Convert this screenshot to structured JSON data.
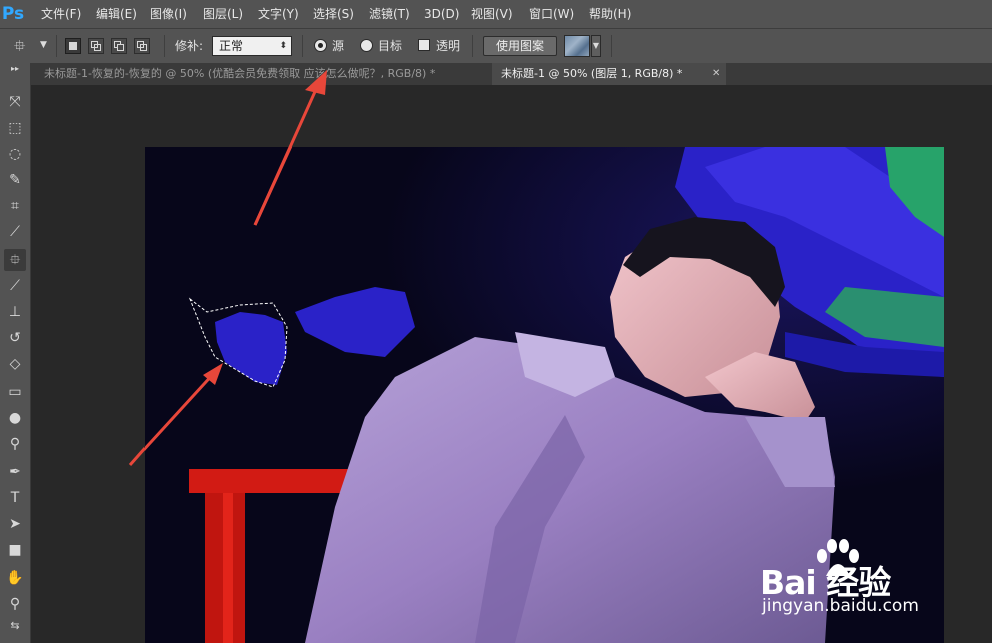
{
  "app": {
    "logo": "Ps"
  },
  "menu": [
    "文件(F)",
    "编辑(E)",
    "图像(I)",
    "图层(L)",
    "文字(Y)",
    "选择(S)",
    "滤镜(T)",
    "3D(D)",
    "视图(V)",
    "窗口(W)",
    "帮助(H)"
  ],
  "options": {
    "patch_label": "修补:",
    "patch_mode": "正常",
    "source_label": "源",
    "target_label": "目标",
    "transparent_label": "透明",
    "use_pattern_label": "使用图案"
  },
  "tabs": [
    {
      "title": "未标题-1-恢复的-恢复的 @ 50% (优酷会员免费领取 应该怎么做呢？, RGB/8) *",
      "active": false
    },
    {
      "title": "未标题-1 @ 50% (图层 1, RGB/8) *",
      "active": true
    }
  ],
  "tools": [
    "move-icon",
    "marquee-icon",
    "lasso-icon",
    "quick-selection-icon",
    "crop-icon",
    "eyedropper-icon",
    "patch-tool-icon",
    "brush-icon",
    "clone-stamp-icon",
    "history-brush-icon",
    "eraser-icon",
    "gradient-icon",
    "blur-icon",
    "dodge-icon",
    "pen-icon",
    "type-icon",
    "path-selection-icon",
    "rectangle-icon",
    "hand-icon",
    "zoom-icon"
  ],
  "watermark": {
    "brand": "Bai 经验",
    "url": "jingyan.baidu.com"
  },
  "colors": {
    "ps_blue": "#31a8ff",
    "annotation_arrow": "#e8473a",
    "chair_red": "#d21b14",
    "robe_purple": "#9a80c2"
  }
}
